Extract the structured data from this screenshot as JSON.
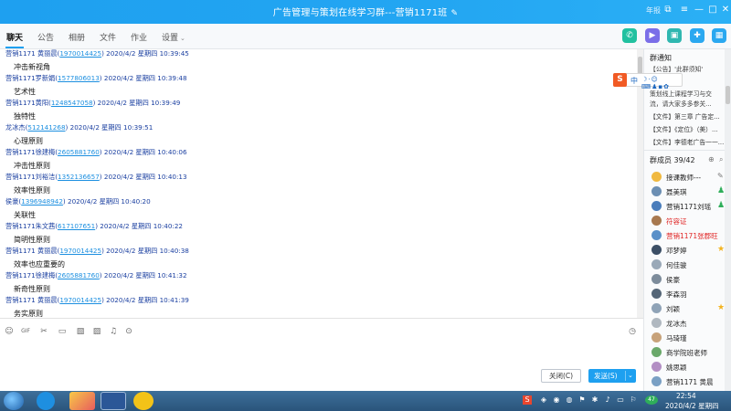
{
  "window": {
    "title": "广告管理与策划在线学习群---营销1171班",
    "annual_label": "年报",
    "icons": [
      "edit-icon",
      "restore-icon",
      "menu-icon",
      "minimize-icon",
      "maximize-icon",
      "close-icon"
    ]
  },
  "tabs": [
    {
      "label": "聊天"
    },
    {
      "label": "公告"
    },
    {
      "label": "相册"
    },
    {
      "label": "文件"
    },
    {
      "label": "作业"
    },
    {
      "label": "设置"
    }
  ],
  "tools": {
    "colors": {
      "phone": "#21c1a0",
      "video": "#7a6ee8",
      "screen": "#2fb7b0",
      "present": "#2aa8f0",
      "more": "#2aa8f0"
    }
  },
  "messages": [
    {
      "sender": "营销1171 黄丽晨(",
      "qq": "1970014425",
      "time": ") 2020/4/2 星期四 10:39:45",
      "text": "冲击新视角"
    },
    {
      "sender": "营销1171罗新娟(",
      "qq": "1577806013",
      "time": ") 2020/4/2 星期四 10:39:48",
      "text": "艺术性"
    },
    {
      "sender": "营销1171黄阳(",
      "qq": "1248547058",
      "time": ") 2020/4/2 星期四 10:39:49",
      "text": "独特性"
    },
    {
      "sender": "龙冰杰(",
      "qq": "512141268",
      "time": ") 2020/4/2 星期四 10:39:51",
      "text": "心理原则"
    },
    {
      "sender": "营销1171徐建梅(",
      "qq": "2605881760",
      "time": ") 2020/4/2 星期四 10:40:06",
      "text": "冲击性原则"
    },
    {
      "sender": "营销1171刘裕洁(",
      "qq": "1352136657",
      "time": ") 2020/4/2 星期四 10:40:13",
      "text": "效率性原则"
    },
    {
      "sender": "侯豪(",
      "qq": "1396948942",
      "time": ") 2020/4/2 星期四 10:40:20",
      "text": "关联性"
    },
    {
      "sender": "营销1171朱文茜(",
      "qq": "617107651",
      "time": ") 2020/4/2 星期四 10:40:22",
      "text": "简明性原则"
    },
    {
      "sender": "营销1171 黄丽晨(",
      "qq": "1970014425",
      "time": ") 2020/4/2 星期四 10:40:38",
      "text": "效率也应重要的"
    },
    {
      "sender": "营销1171徐建梅(",
      "qq": "2605881760",
      "time": ") 2020/4/2 星期四 10:41:32",
      "text": "新奇性原则"
    },
    {
      "sender": "营销1171 黄丽晨(",
      "qq": "1970014425",
      "time": ") 2020/4/2 星期四 10:41:39",
      "text": "务实原则"
    }
  ],
  "input_toolbar": {
    "icons": [
      "emoji-icon",
      "gif-icon",
      "scissors-icon",
      "folder-icon",
      "image-icon",
      "picture-icon",
      "bell-icon",
      "more-icon",
      "history-icon"
    ]
  },
  "buttons": {
    "close": "关闭(C)",
    "send": "发送(S)"
  },
  "panel": {
    "notice_title": "群通知",
    "notice_lines": [
      "【公告】'此群须知'",
      "",
      "策划线上课程学习与交",
      "流，请大家多多参关..."
    ],
    "files": [
      "【文件】第三章 广告定...",
      "【文件】《定位》（美）...",
      "【文件】李德老广告一一..."
    ],
    "members_title": "群成员 39/42",
    "members": [
      {
        "name": "接课教师---",
        "mark": "edit-icon",
        "color": "#222"
      },
      {
        "name": "聂美琪",
        "mark": "admin-icon",
        "color": "#222"
      },
      {
        "name": "营销1171刘瑶",
        "mark": "admin-icon",
        "color": "#222"
      },
      {
        "name": "符容证",
        "mark": "",
        "color": "#e02424"
      },
      {
        "name": "营销1171张郡旺",
        "mark": "",
        "color": "#e02424"
      },
      {
        "name": "邓梦婷",
        "mark": "star-icon",
        "color": "#222"
      },
      {
        "name": "何佳骏",
        "mark": "",
        "color": "#222"
      },
      {
        "name": "侯豪",
        "mark": "",
        "color": "#222"
      },
      {
        "name": "李森羽",
        "mark": "",
        "color": "#222"
      },
      {
        "name": "刘颖",
        "mark": "star-icon",
        "color": "#222"
      },
      {
        "name": "龙冰杰",
        "mark": "",
        "color": "#222"
      },
      {
        "name": "马琦瑾",
        "mark": "",
        "color": "#222"
      },
      {
        "name": "商学院班老师",
        "mark": "",
        "color": "#222"
      },
      {
        "name": "姚思颖",
        "mark": "",
        "color": "#222"
      },
      {
        "name": "营销1171 黄晨",
        "mark": "",
        "color": "#222"
      }
    ]
  },
  "ime": {
    "logo": "S",
    "mode": "中"
  },
  "taskbar": {
    "time": "22:54",
    "date": "2020/4/2 星期四",
    "tray_badge": "47"
  }
}
